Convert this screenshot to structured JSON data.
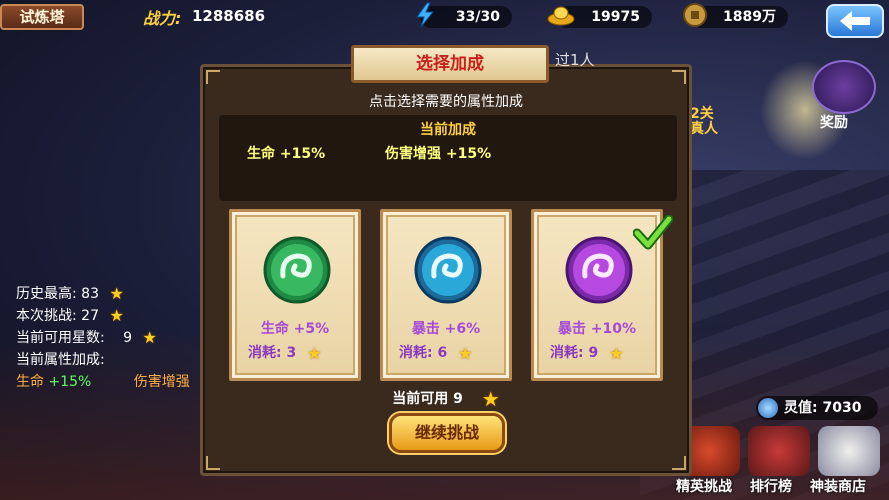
{
  "header": {
    "title": "试炼塔",
    "power_label": "战力:",
    "power_value": "1288686",
    "energy": "33/30",
    "gold": "19975",
    "coins": "1889万"
  },
  "left_stats": {
    "history_label": "历史最高:",
    "history_value": "83",
    "current_label": "本次挑战:",
    "current_value": "27",
    "stars_label": "当前可用星数:",
    "stars_value": "9",
    "attr_label": "当前属性加成:",
    "attr_life": "生命",
    "attr_life_value": "+15%",
    "attr_dmg": "伤害增强"
  },
  "right": {
    "reward_label": "奖励",
    "level_text_1": "2关",
    "level_text_2": "真人",
    "soul_label": "灵值:",
    "soul_value": "7030",
    "bottom_buttons": [
      "精英挑战",
      "排行榜",
      "神装商店"
    ]
  },
  "modal": {
    "title": "选择加成",
    "behind_text": "过1人",
    "subtitle": "点击选择需要的属性加成",
    "current_title": "当前加成",
    "current_items": [
      "生命 +15%",
      "伤害增强 +15%"
    ],
    "cards": [
      {
        "label": "生命 +5%",
        "cost_label": "消耗:",
        "cost": "3",
        "color": "#3aaa5a"
      },
      {
        "label": "暴击 +6%",
        "cost_label": "消耗:",
        "cost": "6",
        "color": "#2a9ac8"
      },
      {
        "label": "暴击 +10%",
        "cost_label": "消耗:",
        "cost": "9",
        "color": "#a83ad0"
      }
    ],
    "available_label": "当前可用",
    "available_value": "9",
    "continue_label": "继续挑战"
  }
}
